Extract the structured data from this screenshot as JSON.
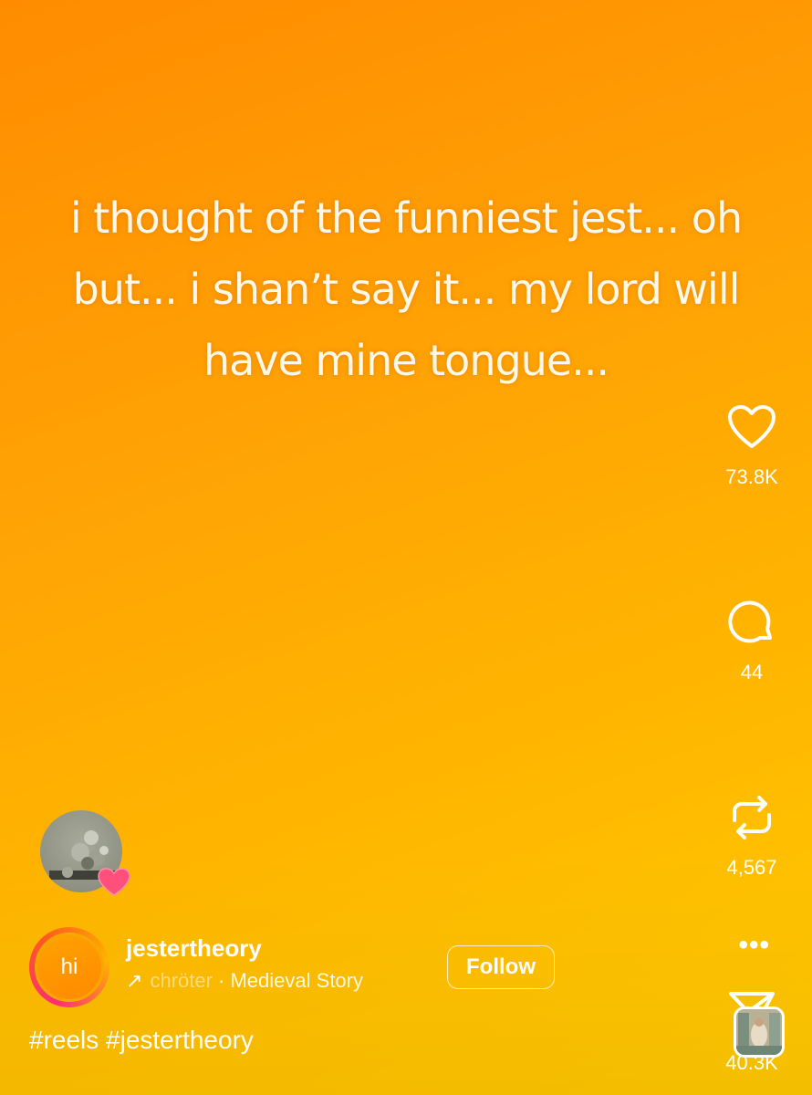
{
  "post": {
    "caption": "i thought of the funniest jest... oh but... i shan’t say it... my lord will have mine tongue...",
    "hashtags": "#reels #jestertheory"
  },
  "actions": {
    "like": {
      "icon": "heart-icon",
      "count": "73.8K"
    },
    "comment": {
      "icon": "comment-icon",
      "count": "44"
    },
    "repost": {
      "icon": "repost-icon",
      "count": "4,567"
    },
    "share": {
      "icon": "send-icon",
      "count": "40.3K"
    },
    "more": {
      "icon": "more-icon",
      "label": "•••"
    }
  },
  "author": {
    "avatar_text": "hi",
    "username": "jestertheory",
    "follow_label": "Follow"
  },
  "audio": {
    "icon": "trending-arrow-icon",
    "arrow": "↗",
    "artist_partial": "chröter",
    "separator": " · ",
    "track": "Medieval Story"
  },
  "colors": {
    "background_top": "#ff8c00",
    "background_bottom": "#ffcb00",
    "avatar_ring": "#ff2d77",
    "badge_heart": "#ff4f7b"
  }
}
